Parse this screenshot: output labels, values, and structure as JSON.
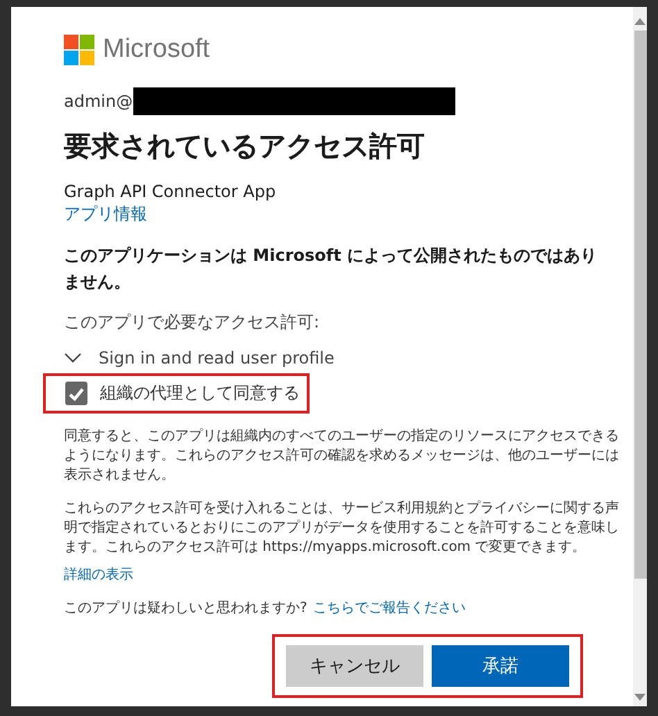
{
  "logo": {
    "text": "Microsoft"
  },
  "account": {
    "prefix": "admin@",
    "redacted": true
  },
  "title": "要求されているアクセス許可",
  "app": {
    "name": "Graph API Connector App",
    "info_link": "アプリ情報"
  },
  "notice": "このアプリケーションは Microsoft によって公開されたものではありません。",
  "permissions_heading": "このアプリで必要なアクセス許可:",
  "permissions": [
    {
      "label": "Sign in and read user profile"
    }
  ],
  "consent": {
    "label": "組織の代理として同意する",
    "checked": true,
    "highlighted": true
  },
  "paragraphs": [
    "同意すると、このアプリは組織内のすべてのユーザーの指定のリソースにアクセスできるようになります。これらのアクセス許可の確認を求めるメッセージは、他のユーザーには表示されません。",
    "これらのアクセス許可を受け入れることは、サービス利用規約とプライバシーに関する声明で指定されているとおりにこのアプリがデータを使用することを許可することを意味します。これらのアクセス許可は https://myapps.microsoft.com で変更できます。"
  ],
  "details_link": "詳細の表示",
  "report": {
    "text": "このアプリは疑わしいと思われますか?",
    "link": "こちらでご報告ください"
  },
  "buttons_highlighted": true,
  "buttons": [
    {
      "label": "キャンセル",
      "kind": "secondary"
    },
    {
      "label": "承諾",
      "kind": "primary"
    }
  ]
}
